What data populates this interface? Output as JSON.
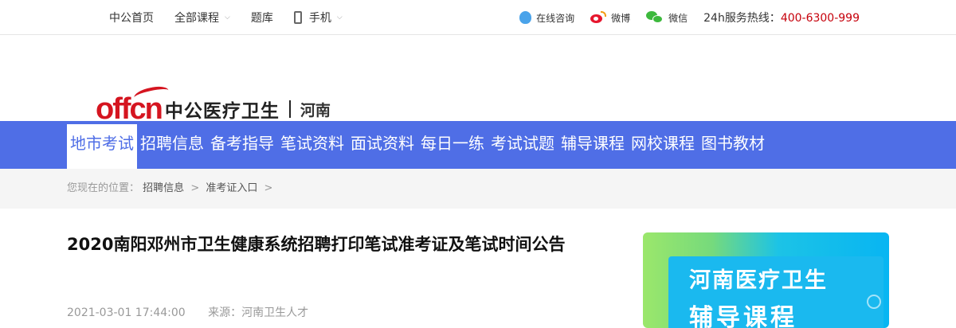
{
  "topbar": {
    "home": "中公首页",
    "all_courses": "全部课程",
    "question_bank": "题库",
    "mobile": "手机",
    "online_consult": "在线咨询",
    "weibo": "微博",
    "wechat": "微信",
    "hotline_label": "24h服务热线：",
    "hotline_number": "400-6300-999"
  },
  "logo": {
    "offcn": "offcn",
    "brand": "中公医疗卫生",
    "city": "河南"
  },
  "nav": {
    "items": [
      "地市考试",
      "招聘信息",
      "备考指导",
      "笔试资料",
      "面试资料",
      "每日一练",
      "考试试题",
      "辅导课程",
      "网校课程",
      "图书教材"
    ],
    "active_index": 0
  },
  "breadcrumb": {
    "prefix": "您现在的位置：",
    "items": [
      "招聘信息",
      "准考证入口"
    ],
    "separator": ">"
  },
  "article": {
    "title": "2020南阳邓州市卫生健康系统招聘打印笔试准考证及笔试时间公告",
    "datetime": "2021-03-01 17:44:00",
    "source": "来源：河南卫生人才"
  },
  "ad": {
    "line1": "河南医疗卫生",
    "line2": "辅导课程"
  },
  "colors": {
    "nav_bg": "#4f6ee6",
    "brand_red": "#d51520",
    "hotline_red": "#c6000b"
  }
}
